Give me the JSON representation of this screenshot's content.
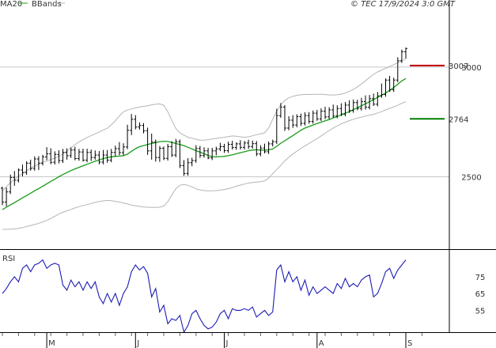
{
  "header": {
    "legend": [
      {
        "label": "MA20",
        "color": "#1a9a1a"
      },
      {
        "label": "BBands",
        "color": "#b5b5b5"
      }
    ],
    "copyright": "© TEC 17/9/2024 3:0 GMT"
  },
  "colors": {
    "price_bars": "#000000",
    "ma20": "#1a9a1a",
    "bbands": "#b5b5b5",
    "rsi": "#1c1cb4",
    "resistance": "#c00000",
    "support": "#008000",
    "frame": "#000000",
    "grid": "#c8c8c8"
  },
  "chart_data": [
    {
      "type": "line",
      "panel": "price",
      "ylim": [
        2170,
        3270
      ],
      "y_ticks": [
        {
          "value": 3000,
          "label": "3000"
        },
        {
          "value": 2500,
          "label": "2500"
        }
      ],
      "x_ticks": [
        {
          "label": "M",
          "day": 11
        },
        {
          "label": "J",
          "day": 33
        },
        {
          "label": "J",
          "day": 55
        },
        {
          "label": "A",
          "day": 78
        },
        {
          "label": "S",
          "day": 100
        }
      ],
      "levels": [
        {
          "label": "3007",
          "value": 3007,
          "color": "#c00000"
        },
        {
          "label": "2764",
          "value": 2764,
          "color": "#008000"
        }
      ],
      "ohlc": [
        [
          2448,
          2455,
          2370,
          2385
        ],
        [
          2385,
          2451,
          2365,
          2431
        ],
        [
          2431,
          2510,
          2421,
          2497
        ],
        [
          2497,
          2526,
          2459,
          2484
        ],
        [
          2484,
          2538,
          2474,
          2531
        ],
        [
          2531,
          2556,
          2502,
          2519
        ],
        [
          2519,
          2571,
          2509,
          2562
        ],
        [
          2562,
          2578,
          2528,
          2538
        ],
        [
          2538,
          2593,
          2528,
          2581
        ],
        [
          2581,
          2594,
          2531,
          2562
        ],
        [
          2562,
          2600,
          2552,
          2591
        ],
        [
          2591,
          2635,
          2576,
          2605
        ],
        [
          2605,
          2630,
          2557,
          2566
        ],
        [
          2566,
          2616,
          2556,
          2602
        ],
        [
          2602,
          2621,
          2561,
          2574
        ],
        [
          2574,
          2627,
          2563,
          2611
        ],
        [
          2611,
          2630,
          2578,
          2596
        ],
        [
          2596,
          2634,
          2586,
          2622
        ],
        [
          2622,
          2637,
          2575,
          2583
        ],
        [
          2583,
          2627,
          2573,
          2613
        ],
        [
          2613,
          2628,
          2569,
          2576
        ],
        [
          2576,
          2628,
          2566,
          2611
        ],
        [
          2611,
          2624,
          2572,
          2588
        ],
        [
          2588,
          2620,
          2578,
          2599
        ],
        [
          2599,
          2617,
          2557,
          2567
        ],
        [
          2567,
          2622,
          2557,
          2599
        ],
        [
          2599,
          2622,
          2564,
          2576
        ],
        [
          2576,
          2627,
          2566,
          2611
        ],
        [
          2611,
          2642,
          2594,
          2628
        ],
        [
          2628,
          2658,
          2598,
          2610
        ],
        [
          2610,
          2653,
          2598,
          2636
        ],
        [
          2636,
          2737,
          2626,
          2712
        ],
        [
          2712,
          2786,
          2690,
          2762
        ],
        [
          2762,
          2781,
          2716,
          2727
        ],
        [
          2727,
          2748,
          2715,
          2734
        ],
        [
          2734,
          2745,
          2698,
          2710
        ],
        [
          2710,
          2724,
          2600,
          2618
        ],
        [
          2618,
          2697,
          2578,
          2658
        ],
        [
          2658,
          2670,
          2569,
          2588
        ],
        [
          2588,
          2640,
          2568,
          2630
        ],
        [
          2630,
          2638,
          2576,
          2584
        ],
        [
          2584,
          2650,
          2574,
          2637
        ],
        [
          2637,
          2662,
          2590,
          2599
        ],
        [
          2599,
          2673,
          2589,
          2660
        ],
        [
          2660,
          2670,
          2540,
          2551
        ],
        [
          2551,
          2576,
          2504,
          2515
        ],
        [
          2515,
          2585,
          2505,
          2564
        ],
        [
          2564,
          2587,
          2548,
          2574
        ],
        [
          2574,
          2644,
          2564,
          2629
        ],
        [
          2629,
          2641,
          2586,
          2597
        ],
        [
          2597,
          2635,
          2587,
          2618
        ],
        [
          2618,
          2632,
          2580,
          2586
        ],
        [
          2586,
          2632,
          2576,
          2618
        ],
        [
          2618,
          2637,
          2598,
          2627
        ],
        [
          2627,
          2655,
          2617,
          2637
        ],
        [
          2637,
          2650,
          2609,
          2619
        ],
        [
          2619,
          2660,
          2609,
          2648
        ],
        [
          2648,
          2664,
          2624,
          2633
        ],
        [
          2633,
          2657,
          2623,
          2650
        ],
        [
          2650,
          2667,
          2624,
          2634
        ],
        [
          2634,
          2663,
          2624,
          2654
        ],
        [
          2654,
          2669,
          2627,
          2638
        ],
        [
          2638,
          2665,
          2628,
          2651
        ],
        [
          2651,
          2663,
          2594,
          2604
        ],
        [
          2604,
          2644,
          2594,
          2631
        ],
        [
          2631,
          2651,
          2607,
          2614
        ],
        [
          2614,
          2661,
          2604,
          2650
        ],
        [
          2650,
          2669,
          2638,
          2660
        ],
        [
          2660,
          2810,
          2650,
          2779
        ],
        [
          2779,
          2836,
          2769,
          2818
        ],
        [
          2818,
          2827,
          2709,
          2722
        ],
        [
          2722,
          2776,
          2712,
          2758
        ],
        [
          2758,
          2781,
          2723,
          2736
        ],
        [
          2736,
          2785,
          2726,
          2774
        ],
        [
          2774,
          2788,
          2732,
          2744
        ],
        [
          2744,
          2794,
          2734,
          2779
        ],
        [
          2779,
          2795,
          2742,
          2752
        ],
        [
          2752,
          2802,
          2742,
          2790
        ],
        [
          2790,
          2805,
          2755,
          2764
        ],
        [
          2764,
          2812,
          2754,
          2799
        ],
        [
          2799,
          2819,
          2763,
          2773
        ],
        [
          2773,
          2817,
          2763,
          2805
        ],
        [
          2805,
          2829,
          2769,
          2777
        ],
        [
          2777,
          2826,
          2767,
          2811
        ],
        [
          2811,
          2835,
          2777,
          2786
        ],
        [
          2786,
          2841,
          2776,
          2827
        ],
        [
          2827,
          2849,
          2791,
          2802
        ],
        [
          2802,
          2852,
          2792,
          2838
        ],
        [
          2838,
          2851,
          2803,
          2812
        ],
        [
          2812,
          2860,
          2802,
          2843
        ],
        [
          2843,
          2871,
          2806,
          2817
        ],
        [
          2817,
          2873,
          2807,
          2856
        ],
        [
          2856,
          2879,
          2823,
          2831
        ],
        [
          2831,
          2887,
          2821,
          2869
        ],
        [
          2869,
          2925,
          2860,
          2875
        ],
        [
          2875,
          2948,
          2865,
          2941
        ],
        [
          2941,
          2960,
          2887,
          2897
        ],
        [
          2897,
          2952,
          2887,
          2941
        ],
        [
          2941,
          3045,
          2931,
          3029
        ],
        [
          3029,
          3080,
          3019,
          3070
        ],
        [
          3070,
          3089,
          3039,
          3085
        ]
      ],
      "ma20": [
        2350,
        2361,
        2372,
        2382,
        2393,
        2404,
        2414,
        2425,
        2436,
        2446,
        2457,
        2468,
        2479,
        2489,
        2500,
        2510,
        2519,
        2528,
        2536,
        2543,
        2550,
        2557,
        2564,
        2571,
        2577,
        2583,
        2588,
        2591,
        2593,
        2594,
        2596,
        2603,
        2616,
        2628,
        2637,
        2642,
        2647,
        2652,
        2656,
        2660,
        2662,
        2661,
        2657,
        2652,
        2647,
        2642,
        2634,
        2627,
        2619,
        2612,
        2605,
        2597,
        2592,
        2591,
        2592,
        2593,
        2596,
        2600,
        2605,
        2610,
        2614,
        2619,
        2622,
        2623,
        2622,
        2621,
        2623,
        2627,
        2639,
        2653,
        2664,
        2676,
        2688,
        2700,
        2712,
        2722,
        2729,
        2736,
        2743,
        2749,
        2755,
        2761,
        2768,
        2775,
        2782,
        2790,
        2797,
        2806,
        2815,
        2824,
        2833,
        2842,
        2852,
        2862,
        2872,
        2882,
        2894,
        2907,
        2922,
        2937,
        2948
      ],
      "bb_upper": [
        2436,
        2455,
        2473,
        2488,
        2502,
        2516,
        2528,
        2539,
        2549,
        2558,
        2566,
        2572,
        2578,
        2585,
        2593,
        2604,
        2617,
        2632,
        2646,
        2659,
        2670,
        2679,
        2688,
        2696,
        2704,
        2713,
        2721,
        2737,
        2756,
        2777,
        2796,
        2804,
        2809,
        2814,
        2818,
        2821,
        2824,
        2828,
        2831,
        2832,
        2826,
        2797,
        2757,
        2720,
        2700,
        2690,
        2680,
        2676,
        2671,
        2667,
        2667,
        2669,
        2672,
        2675,
        2678,
        2680,
        2683,
        2686,
        2685,
        2682,
        2680,
        2682,
        2687,
        2692,
        2696,
        2700,
        2723,
        2762,
        2799,
        2829,
        2848,
        2860,
        2867,
        2871,
        2874,
        2875,
        2875,
        2876,
        2876,
        2876,
        2875,
        2873,
        2873,
        2874,
        2877,
        2882,
        2890,
        2899,
        2910,
        2923,
        2937,
        2953,
        2967,
        2978,
        2987,
        2995,
        3003,
        3011,
        3020,
        3028,
        3039
      ],
      "bb_lower": [
        2260,
        2260,
        2261,
        2262,
        2265,
        2268,
        2273,
        2278,
        2282,
        2288,
        2294,
        2301,
        2310,
        2320,
        2330,
        2338,
        2345,
        2351,
        2358,
        2364,
        2369,
        2373,
        2378,
        2383,
        2387,
        2390,
        2392,
        2391,
        2388,
        2385,
        2380,
        2376,
        2371,
        2368,
        2365,
        2362,
        2361,
        2360,
        2360,
        2361,
        2367,
        2386,
        2417,
        2446,
        2461,
        2465,
        2461,
        2454,
        2445,
        2440,
        2437,
        2436,
        2436,
        2437,
        2439,
        2442,
        2446,
        2450,
        2457,
        2462,
        2467,
        2471,
        2474,
        2476,
        2478,
        2481,
        2494,
        2514,
        2533,
        2552,
        2572,
        2589,
        2604,
        2617,
        2629,
        2641,
        2652,
        2663,
        2674,
        2686,
        2698,
        2711,
        2722,
        2732,
        2741,
        2749,
        2756,
        2762,
        2768,
        2772,
        2777,
        2781,
        2785,
        2791,
        2797,
        2805,
        2812,
        2819,
        2826,
        2835,
        2842
      ]
    },
    {
      "type": "line",
      "panel": "rsi",
      "title": "RSI",
      "ylim": [
        42,
        90
      ],
      "y_ticks": [
        {
          "value": 75,
          "label": "75"
        },
        {
          "value": 65,
          "label": "65"
        },
        {
          "value": 55,
          "label": "55"
        }
      ],
      "values": [
        65,
        68,
        72,
        75,
        72,
        80,
        82,
        78,
        82,
        83,
        85,
        80,
        82,
        83,
        82,
        70,
        67,
        73,
        69,
        72,
        67,
        72,
        68,
        72,
        63,
        59,
        65,
        60,
        65,
        58,
        65,
        69,
        78,
        82,
        79,
        81,
        77,
        63,
        68,
        54,
        58,
        47,
        50,
        49,
        52,
        42,
        46,
        53,
        55,
        50,
        46,
        44,
        45,
        48,
        53,
        55,
        50,
        56,
        55,
        55,
        56,
        55,
        57,
        51,
        53,
        55,
        52,
        54,
        79,
        82,
        72,
        78,
        72,
        75,
        67,
        73,
        64,
        69,
        65,
        67,
        69,
        67,
        65,
        71,
        68,
        74,
        69,
        71,
        69,
        73,
        75,
        76,
        63,
        65,
        71,
        78,
        80,
        74,
        79,
        82,
        85
      ]
    }
  ]
}
